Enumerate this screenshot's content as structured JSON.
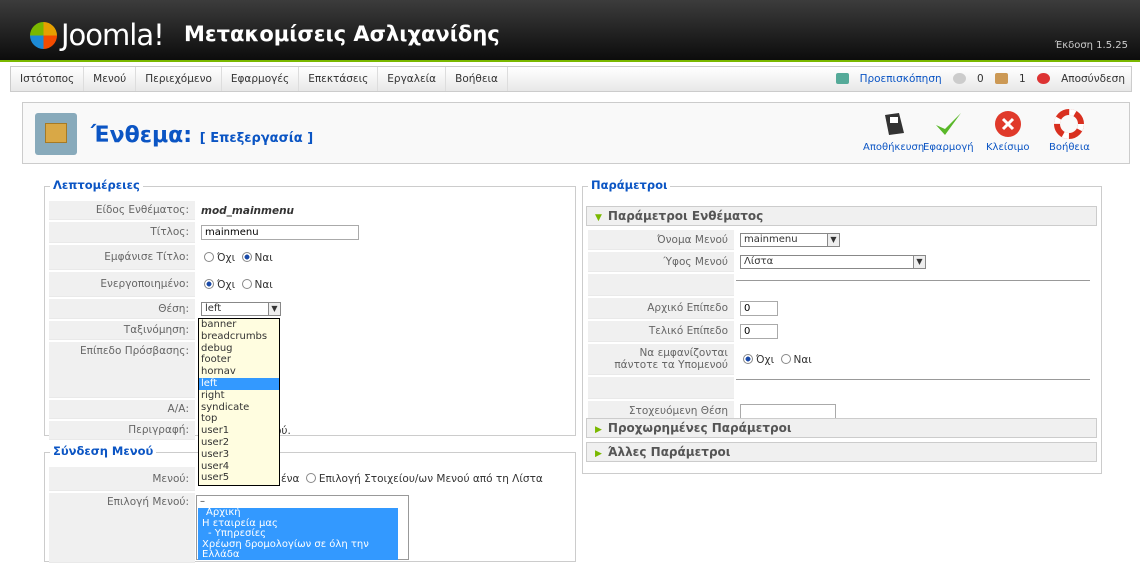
{
  "header": {
    "brand": "Joomla!",
    "site_name": "Μετακομίσεις Ασλιχανίδης",
    "version": "Έκδοση 1.5.25"
  },
  "menu": {
    "items": [
      "Ιστότοπος",
      "Μενού",
      "Περιεχόμενο",
      "Εφαρμογές",
      "Επεκτάσεις",
      "Εργαλεία",
      "Βοήθεια"
    ],
    "preview": "Προεπισκόπηση",
    "messages": "0",
    "users": "1",
    "logout": "Αποσύνδεση"
  },
  "toolbar": {
    "title": "Ένθεμα:",
    "subtitle": "[ Επεξεργασία ]",
    "save": "Αποθήκευση",
    "apply": "Εφαρμογή",
    "close": "Κλείσιμο",
    "help": "Βοήθεια"
  },
  "details": {
    "legend": "Λεπτομέρειες",
    "type_label": "Είδος Ενθέματος:",
    "type_value": "mod_mainmenu",
    "title_label": "Τίτλος:",
    "title_value": "mainmenu",
    "show_title_label": "Εμφάνισε Τίτλο:",
    "no": "Όχι",
    "yes": "Ναι",
    "enabled_label": "Ενεργοποιημένο:",
    "position_label": "Θέση:",
    "position_value": "left",
    "order_label": "Ταξινόμηση:",
    "access_label": "Επίπεδο Πρόσβασης:",
    "id_label": "Α/Α:",
    "desc_label": "Περιγραφή:",
    "desc_tail": "ού."
  },
  "position_options": [
    "banner",
    "breadcrumbs",
    "debug",
    "footer",
    "hornav",
    "left",
    "right",
    "syndicate",
    "top",
    "user1",
    "user2",
    "user3",
    "user4",
    "user5"
  ],
  "menu_link": {
    "legend": "Σύνδεση Μενού",
    "menus_label": "Μενού:",
    "menus_tail": "ένα",
    "select_option": "Επιλογή Στοιχείου/ων Μενού από τη Λίστα",
    "select_label": "Επιλογή Μενού:",
    "list": [
      "–",
      "Αρχική",
      "Η εταιρεία μας",
      "- Υπηρεσίες",
      "Χρέωση δρομολογίων σε όλη την Ελλάδα"
    ]
  },
  "params": {
    "legend": "Παράμετροι",
    "module_params": "Παράμετροι Ενθέματος",
    "menu_name_label": "Όνομα Μενού",
    "menu_name_value": "mainmenu",
    "style_label": "Ύφος Μενού",
    "style_value": "Λίστα",
    "start_label": "Αρχικό Επίπεδο",
    "start_value": "0",
    "end_label": "Τελικό Επίπεδο",
    "end_value": "0",
    "always_label": "Να εμφανίζονται πάντοτε τα Υπομενού",
    "target_label": "Στοχευόμενη Θέση",
    "advanced": "Προχωρημένες Παράμετροι",
    "other": "Άλλες Παράμετροι"
  }
}
